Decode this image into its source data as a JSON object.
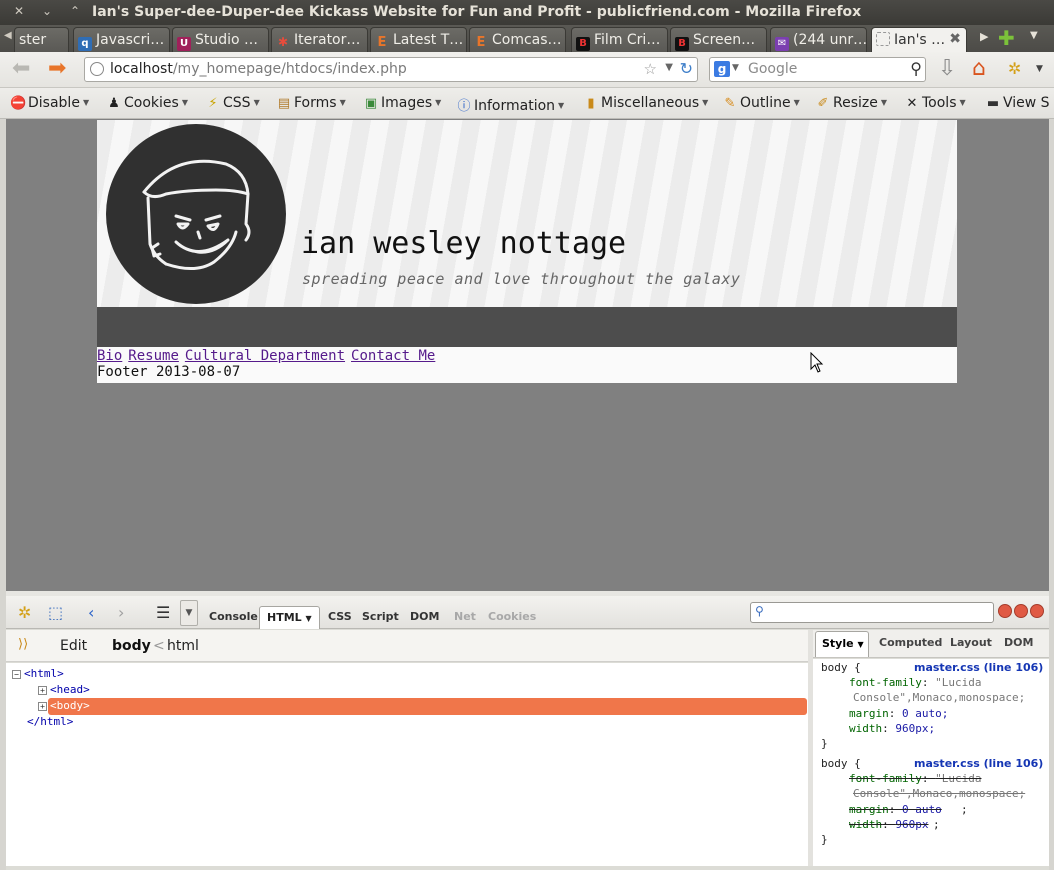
{
  "window": {
    "title": "Ian's Super-dee-Duper-dee Kickass Website for Fun and Profit - publicfriend.com - Mozilla Firefox"
  },
  "tabs": [
    {
      "label": "ster",
      "icon": "generic-page-icon",
      "color": "#888888"
    },
    {
      "label": "Javascri…",
      "icon": "q-site-icon",
      "color": "#2f6db5"
    },
    {
      "label": "Studio …",
      "icon": "u-site-icon",
      "color": "#a0205a"
    },
    {
      "label": "Iterator…",
      "icon": "bug-site-icon",
      "color": "#c0392b"
    },
    {
      "label": "Latest T…",
      "icon": "e-site-icon",
      "color": "#e8752a"
    },
    {
      "label": "Comcas…",
      "icon": "e-site-icon",
      "color": "#e8752a"
    },
    {
      "label": "Film Cri…",
      "icon": "b-site-icon",
      "color": "#b01030"
    },
    {
      "label": "Screen…",
      "icon": "b-site-icon",
      "color": "#b01030"
    },
    {
      "label": "(244 unr…",
      "icon": "mail-site-icon",
      "color": "#7b3fb0"
    },
    {
      "label": "Ian's …",
      "icon": "blank-page-icon",
      "color": "#ffffff",
      "active": true
    }
  ],
  "navbar": {
    "url_host": "localhost",
    "url_path": "/my_homepage/htdocs/index.php",
    "search_placeholder": "Google"
  },
  "devtoolbar": {
    "items": [
      {
        "label": "Disable",
        "icon": "no-entry-icon"
      },
      {
        "label": "Cookies",
        "icon": "person-icon"
      },
      {
        "label": "CSS",
        "icon": "wand-icon"
      },
      {
        "label": "Forms",
        "icon": "clipboard-icon"
      },
      {
        "label": "Images",
        "icon": "picture-icon"
      },
      {
        "label": "Information",
        "icon": "info-icon"
      },
      {
        "label": "Miscellaneous",
        "icon": "book-icon"
      },
      {
        "label": "Outline",
        "icon": "pencil-icon"
      },
      {
        "label": "Resize",
        "icon": "ruler-icon"
      },
      {
        "label": "Tools",
        "icon": "wrench-icon"
      },
      {
        "label": "View S",
        "icon": "terminal-icon"
      }
    ]
  },
  "site": {
    "name": "ian wesley nottage",
    "tagline": "spreading peace and love throughout the galaxy",
    "nav_links": [
      "Bio",
      "Resume",
      "Cultural Department",
      "Contact Me"
    ],
    "footer": "Footer 2013-08-07"
  },
  "firebug": {
    "panels": [
      {
        "label": "Console",
        "enabled": true
      },
      {
        "label": "HTML",
        "enabled": true,
        "active": true
      },
      {
        "label": "CSS",
        "enabled": true
      },
      {
        "label": "Script",
        "enabled": true
      },
      {
        "label": "DOM",
        "enabled": true
      },
      {
        "label": "Net",
        "enabled": false
      },
      {
        "label": "Cookies",
        "enabled": false
      }
    ],
    "edit_label": "Edit",
    "breadcrumb": {
      "current": "body",
      "sep": "<",
      "parent": "html"
    },
    "tree": {
      "html_open": "<html>",
      "head": "<head>",
      "body": "<body>",
      "html_close": "</html>"
    },
    "side_tabs": [
      "Style",
      "Computed",
      "Layout",
      "DOM"
    ],
    "rules": [
      {
        "selector": "body {",
        "source": "master.css (line 106)",
        "props": [
          {
            "name": "font-family",
            "value": "\"Lucida",
            "value2": "Console\",Monaco,monospace;"
          },
          {
            "name": "margin",
            "value": "0 auto;"
          },
          {
            "name": "width",
            "value": "960px;"
          }
        ],
        "close": "}"
      },
      {
        "selector": "body {",
        "source": "master.css (line 106)",
        "props": [
          {
            "name": "font-family",
            "value": "\"Lucida",
            "value2": "Console\",Monaco,monospace;"
          },
          {
            "name": "margin",
            "value": "0 auto"
          },
          {
            "name": "width",
            "value": "960px"
          }
        ],
        "close": "}",
        "overridden": true
      }
    ]
  }
}
